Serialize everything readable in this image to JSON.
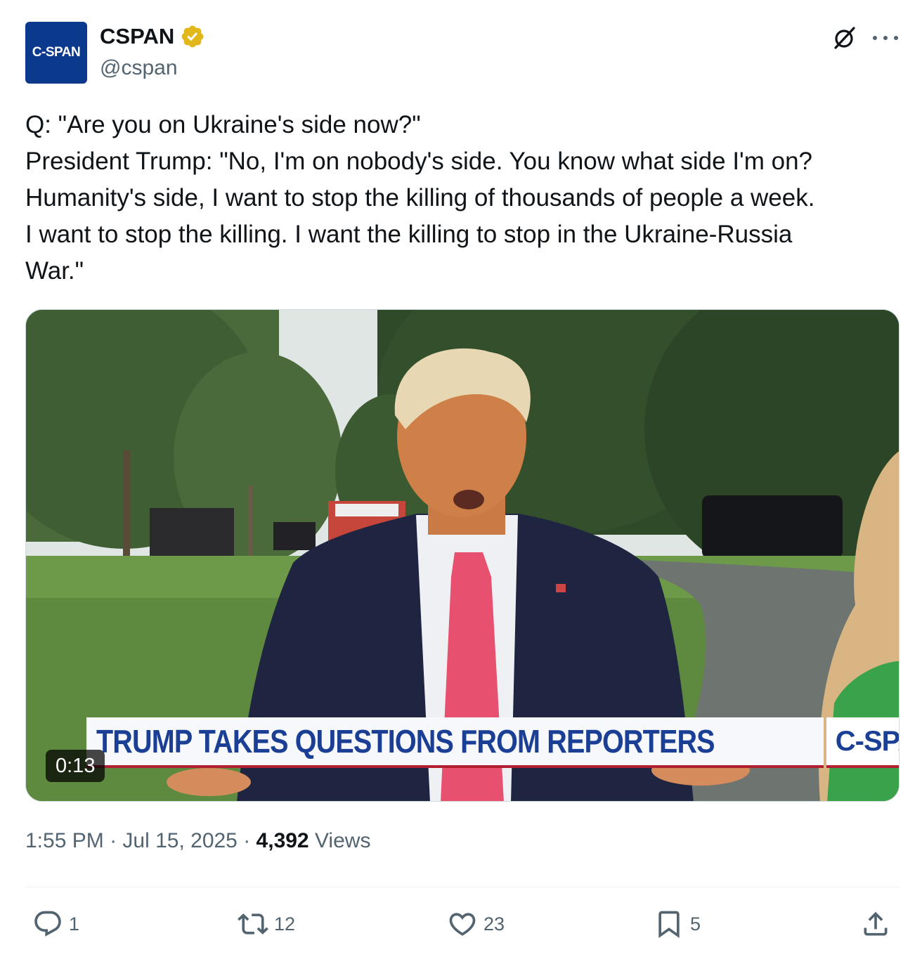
{
  "account": {
    "avatar_text": "C-SPAN",
    "display_name": "CSPAN",
    "handle": "@cspan",
    "verified_color": "#e2b719"
  },
  "tweet": {
    "lines": [
      "Q: \"Are you on Ukraine's side now?\"",
      "President Trump: \"No, I'm on nobody's side. You know what side I'm on?",
      "Humanity's side, I want to stop the killing of thousands of people a week.",
      "I want to stop the killing. I want the killing to stop in the Ukraine-Russia",
      "War.\""
    ]
  },
  "video": {
    "lower_third": "TRUMP TAKES QUESTIONS FROM REPORTERS",
    "brand": "C-SPAN",
    "duration": "0:13"
  },
  "meta": {
    "time": "1:55 PM",
    "separator": " · ",
    "date": "Jul 15, 2025",
    "views_count": "4,392",
    "views_label": " Views"
  },
  "actions": {
    "replies": "1",
    "reposts": "12",
    "likes": "23",
    "bookmarks": "5"
  },
  "icons": {
    "header": [
      "grok-icon",
      "more-icon"
    ],
    "actions": [
      "reply-icon",
      "repost-icon",
      "like-icon",
      "bookmark-icon",
      "share-icon"
    ]
  },
  "colors": {
    "text_primary": "#0f1419",
    "text_secondary": "#536471",
    "brand_blue": "#1b3f94"
  }
}
